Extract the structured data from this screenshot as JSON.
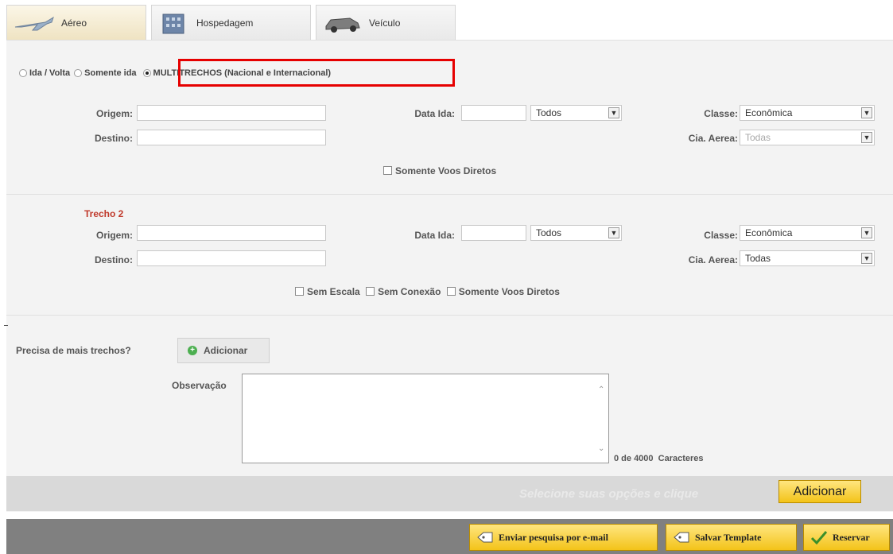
{
  "tabs": [
    {
      "label": "Aéreo",
      "icon": "airplane-icon",
      "active": true
    },
    {
      "label": "Hospedagem",
      "icon": "hotel-icon",
      "active": false
    },
    {
      "label": "Veículo",
      "icon": "car-icon",
      "active": false
    }
  ],
  "trip_type": {
    "options": [
      {
        "label": "Ida / Volta",
        "selected": false
      },
      {
        "label": "Somente ida",
        "selected": false
      },
      {
        "label": "MULTITRECHOS (Nacional e Internacional)",
        "selected": true
      }
    ]
  },
  "segment1": {
    "origem_label": "Origem:",
    "destino_label": "Destino:",
    "data_ida_label": "Data Ida:",
    "time_value": "Todos",
    "classe_label": "Classe:",
    "classe_value": "Econômica",
    "cia_label": "Cia. Aerea:",
    "cia_value": "Todas",
    "direct_only_label": "Somente Voos Diretos"
  },
  "segment2": {
    "title": "Trecho 2",
    "origem_label": "Origem:",
    "destino_label": "Destino:",
    "data_ida_label": "Data Ida:",
    "time_value": "Todos",
    "classe_label": "Classe:",
    "classe_value": "Econômica",
    "cia_label": "Cia. Aerea:",
    "cia_value": "Todas",
    "sem_escala_label": "Sem Escala",
    "sem_conexao_label": "Sem Conexão",
    "direct_only_label": "Somente Voos Diretos"
  },
  "more_segments": {
    "question": "Precisa de mais trechos?",
    "add_label": "Adicionar"
  },
  "observacao": {
    "label": "Observação",
    "counter": "0 de 4000  Caracteres"
  },
  "action_bar": {
    "hint": "Selecione suas opções e clique",
    "add_label": "Adicionar"
  },
  "footer": {
    "email_label": "Enviar pesquisa por e-mail",
    "template_label": "Salvar Template",
    "reserve_label": "Reservar"
  },
  "colors": {
    "highlight": "#e60000",
    "trecho": "#c0392b",
    "button_yellow": "#f3c319"
  }
}
